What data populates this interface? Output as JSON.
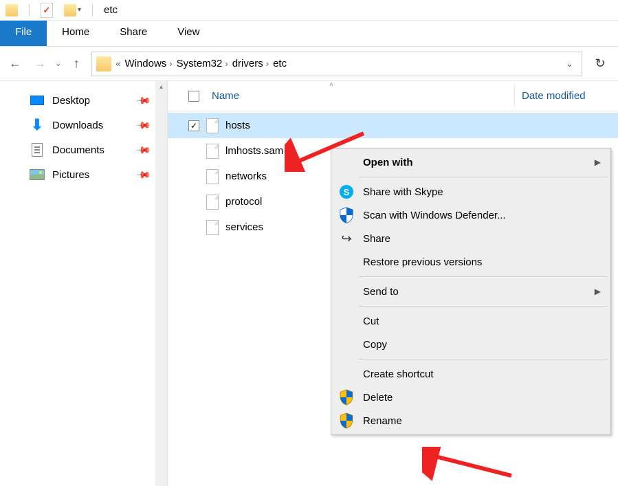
{
  "title_bar": {
    "title": "etc"
  },
  "ribbon": {
    "file": "File",
    "home": "Home",
    "share": "Share",
    "view": "View"
  },
  "breadcrumb": {
    "prefix": "«",
    "parts": [
      "Windows",
      "System32",
      "drivers",
      "etc"
    ]
  },
  "sidebar": {
    "items": [
      {
        "label": "Desktop",
        "icon": "desktop"
      },
      {
        "label": "Downloads",
        "icon": "download"
      },
      {
        "label": "Documents",
        "icon": "document"
      },
      {
        "label": "Pictures",
        "icon": "picture"
      }
    ]
  },
  "columns": {
    "name": "Name",
    "date": "Date modified"
  },
  "files": [
    {
      "name": "hosts",
      "selected": true
    },
    {
      "name": "lmhosts.sam",
      "selected": false
    },
    {
      "name": "networks",
      "selected": false
    },
    {
      "name": "protocol",
      "selected": false
    },
    {
      "name": "services",
      "selected": false
    }
  ],
  "context_menu": {
    "open_with": "Open with",
    "share_skype": "Share with Skype",
    "scan_defender": "Scan with Windows Defender...",
    "share": "Share",
    "restore": "Restore previous versions",
    "send_to": "Send to",
    "cut": "Cut",
    "copy": "Copy",
    "create_shortcut": "Create shortcut",
    "delete": "Delete",
    "rename": "Rename"
  }
}
